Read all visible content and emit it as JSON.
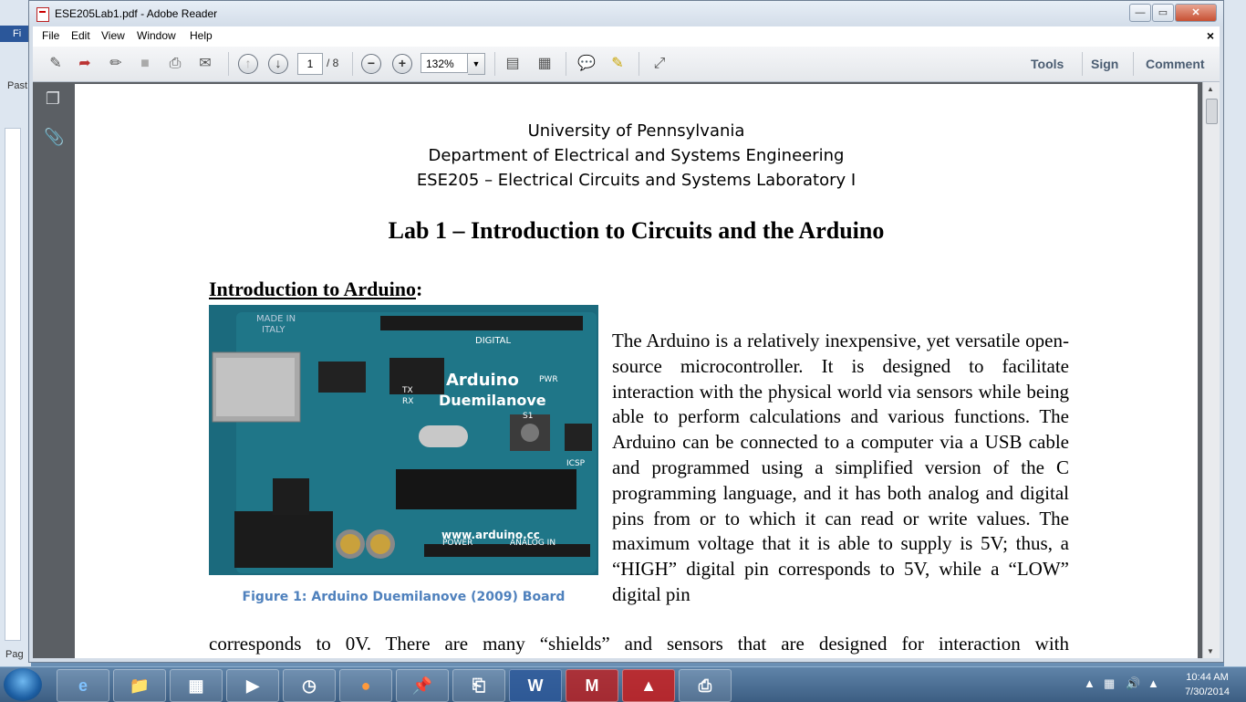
{
  "window": {
    "title": "ESE205Lab1.pdf - Adobe Reader",
    "minimize": "—",
    "restore": "▭",
    "close": "✕"
  },
  "menu": {
    "items": [
      "File",
      "Edit",
      "View",
      "Window",
      "Help"
    ],
    "close": "×"
  },
  "toolbar": {
    "current_page": "1",
    "page_total": "/ 8",
    "zoom": "132%",
    "tools": "Tools",
    "sign": "Sign",
    "comment": "Comment"
  },
  "document": {
    "header_lines": [
      "University of Pennsylvania",
      "Department of Electrical and Systems Engineering",
      "ESE205 – Electrical Circuits and Systems Laboratory I"
    ],
    "lab_title": "Lab 1 – Introduction to Circuits and the Arduino",
    "section_heading": "Introduction to Arduino",
    "section_colon": ":",
    "figure_caption": "Figure 1: Arduino Duemilanove (2009) Board",
    "board_labels": {
      "made_in": "MADE IN",
      "italy": "ITALY",
      "digital": "DIGITAL",
      "arduino": "Arduino",
      "duemilanove": "Duemilanove",
      "website": "www.arduino.cc",
      "power": "POWER",
      "analog_in": "ANALOG IN",
      "icsp": "ICSP",
      "pwr": "PWR",
      "tx": "TX",
      "rx": "RX",
      "s1": "S1"
    },
    "paragraph": "The Arduino is a relatively inexpensive, yet versatile open-source microcontroller.  It is designed to facilitate interaction with the physical world via sensors while being able to perform calculations and various functions.  The Arduino can be connected to a computer via a USB cable and programmed using a simplified version of the C programming language, and it has both analog and digital pins from or to which it can read or write values.  The maximum voltage that it is able to supply is 5V; thus, a “HIGH” digital pin corresponds to 5V, while a “LOW” digital pin",
    "last_line": "corresponds to 0V.  There are many “shields” and sensors that are designed for interaction with"
  },
  "taskbar": {
    "word_letter": "W",
    "mcafee_letter": "M",
    "time": "10:44 AM",
    "date": "7/30/2014"
  },
  "background_app": {
    "ribbon_tab": "Fi",
    "paste": "Past",
    "page_label": "Pag"
  },
  "colors": {
    "caption": "#4f81bd",
    "board": "#1a6a7c",
    "taskbar": "#3c5e82"
  }
}
